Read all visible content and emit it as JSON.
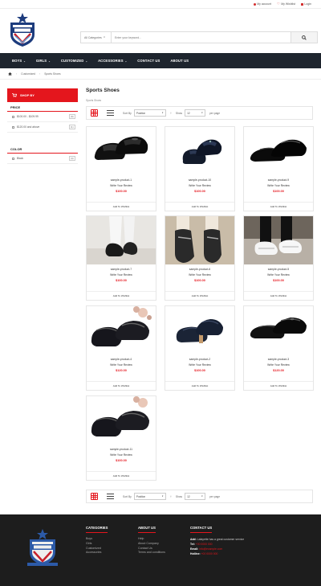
{
  "topbar": {
    "links": [
      {
        "label": "My account",
        "icon": "user-icon"
      },
      {
        "label": "My Wishlist",
        "icon": "heart-icon"
      },
      {
        "label": "Login",
        "icon": "lock-icon"
      }
    ]
  },
  "header": {
    "logo_icon": "jamesons-shield-logo",
    "search": {
      "category": "All Categories",
      "placeholder": "Enter your keyword..."
    }
  },
  "nav": {
    "items": [
      {
        "label": "BOYS",
        "has_dropdown": true
      },
      {
        "label": "GIRLS",
        "has_dropdown": true
      },
      {
        "label": "CUSTOMIZED",
        "has_dropdown": true
      },
      {
        "label": "ACCESSORIES",
        "has_dropdown": true
      },
      {
        "label": "CONTACT US",
        "has_dropdown": false
      },
      {
        "label": "ABOUT US",
        "has_dropdown": false
      }
    ]
  },
  "breadcrumb": {
    "items": [
      "Customized",
      "Sports Shoes"
    ]
  },
  "sidebar": {
    "shop_by": "SHOP BY",
    "price_title": "PRICE",
    "price_filters": [
      {
        "label": "$100.00 - $109.99",
        "count": "(9)"
      },
      {
        "label": "$120.00 and above",
        "count": "(1)"
      }
    ],
    "color_title": "COLOR",
    "color_filters": [
      {
        "label": "Black",
        "count": "(4)"
      }
    ]
  },
  "main": {
    "title": "Sports Shoes",
    "subtitle": "Sports Shoes",
    "toolbar": {
      "sort_label": "Sort By",
      "sort_value": "Position",
      "show_label": "Show",
      "show_value": "12",
      "per_page": "per page"
    },
    "products": [
      {
        "name": "sample-product-1",
        "review": "Write Your Review",
        "price": "$100.00",
        "wishlist": "Add To Wishlist"
      },
      {
        "name": "sample-product-10",
        "review": "Write Your Review",
        "price": "$100.00",
        "wishlist": "Add To Wishlist"
      },
      {
        "name": "sample-product-9",
        "review": "Write Your Review",
        "price": "$100.00",
        "wishlist": "Add To Wishlist"
      },
      {
        "name": "sample-product-7",
        "review": "Write Your Review",
        "price": "$100.00",
        "wishlist": "Add To Wishlist"
      },
      {
        "name": "sample-product-6",
        "review": "Write Your Review",
        "price": "$100.00",
        "wishlist": "Add To Wishlist"
      },
      {
        "name": "sample-product-5",
        "review": "Write Your Review",
        "price": "$100.00",
        "wishlist": "Add To Wishlist"
      },
      {
        "name": "sample-product-4",
        "review": "Write Your Review",
        "price": "$120.00",
        "wishlist": "Add To Wishlist"
      },
      {
        "name": "sample-product-2",
        "review": "Write Your Review",
        "price": "$100.00",
        "wishlist": "Add To Wishlist"
      },
      {
        "name": "sample-product-3",
        "review": "Write Your Review",
        "price": "$120.00",
        "wishlist": "Add To Wishlist"
      },
      {
        "name": "sample-product-11",
        "review": "Write Your Review",
        "price": "$100.00",
        "wishlist": "Add To Wishlist"
      }
    ]
  },
  "footer": {
    "categories_title": "CATEGORIES",
    "categories": [
      "Boys",
      "Girls",
      "Customized",
      "Accessories"
    ],
    "about_title": "ABOUT US",
    "about_links": [
      "Help",
      "About Company",
      "Contact Us",
      "Terms and conditions"
    ],
    "contact_title": "CONTACT US",
    "contact": {
      "add_label": "Add:",
      "add_value": "Lafayette has a great customer service",
      "tel_label": "Tel:",
      "tel_value": "+00 0000 000",
      "email_label": "Email:",
      "email_value": "info@example.com",
      "hotline_label": "Hotline:",
      "hotline_value": "+00 0000 000"
    }
  },
  "colors": {
    "accent": "#e4161d",
    "nav_bg": "#1e252e",
    "footer_bg": "#1d1d1d"
  }
}
